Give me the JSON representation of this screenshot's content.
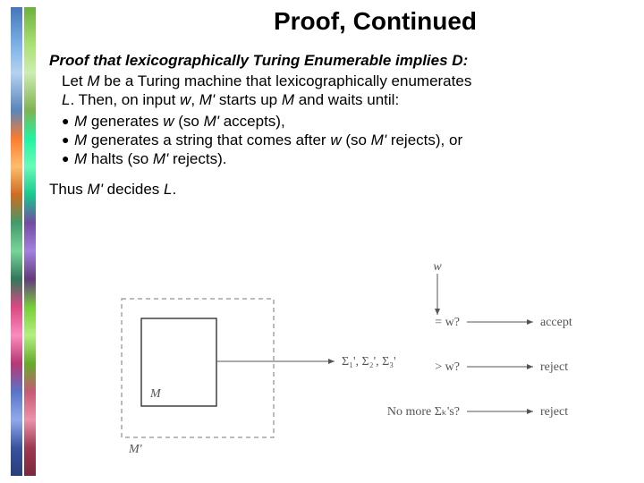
{
  "title": "Proof, Continued",
  "subtitle": "Proof that lexicographically Turing Enumerable implies D:",
  "para1a": "Let ",
  "para1_M": "M",
  "para1b": " be a Turing machine that lexicographically enumerates ",
  "para2a": "L",
  "para2b": ".  Then, on input ",
  "para2_w": "w",
  "para2c": ", ",
  "para2_Mp": "M'",
  "para2d": " starts up ",
  "para2_M": "M",
  "para2e": " and waits until:",
  "bullets": {
    "0": {
      "M": "M",
      "t1": " generates ",
      "w": "w",
      "t2": " (so ",
      "Mp": "M'",
      "t3": " accepts),"
    },
    "1": {
      "M": "M",
      "t1": " generates a string that comes after ",
      "w": "w",
      "t2": " (so ",
      "Mp": "M'",
      "t3": " rejects), or"
    },
    "2": {
      "M": "M",
      "t1": " halts (so ",
      "Mp": "M'",
      "t2": " rejects)."
    }
  },
  "conclusion_a": "Thus ",
  "conclusion_Mp": "M'",
  "conclusion_b": " decides ",
  "conclusion_L": "L",
  "conclusion_c": ".",
  "diagram": {
    "w": "w",
    "M": "M",
    "Mp": "M'",
    "sigma_seq": "Σ₁', Σ₂', Σ₃'",
    "q1": "= w?",
    "q2": "> w?",
    "q3": "No more Σₖ's?",
    "accept": "accept",
    "reject1": "reject",
    "reject2": "reject"
  }
}
